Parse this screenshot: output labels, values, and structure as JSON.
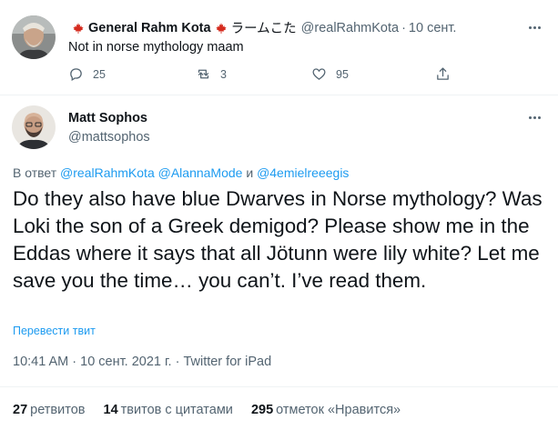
{
  "reply_tweet": {
    "display_name": "General Rahm Kota",
    "display_name_suffix": "ラームこた",
    "handle": "@realRahmKota",
    "separator": "·",
    "time": "10 сент.",
    "text": "Not in norse mythology maam",
    "flag_icon": "maple-leaf-icon",
    "flag_color": "#d52b1e",
    "actions": {
      "reply_count": "25",
      "retweet_count": "3",
      "like_count": "95"
    }
  },
  "main_tweet": {
    "display_name": "Matt Sophos",
    "handle": "@mattsophos",
    "replying_prefix": "В ответ",
    "mentions": [
      "@realRahmKota",
      "@AlannaMode",
      "@4emielreeegis"
    ],
    "mention_conjunction": "и",
    "text": "Do they also have blue Dwarves in Norse mythology? Was Loki the son of a Greek demigod? Please show me in the Eddas where it says that all Jötunn were lily white? Let me save you the time… you can’t. I’ve read them.",
    "translate_label": "Перевести твит",
    "timestamp": "10:41 AM · 10 сент. 2021 г. · Twitter for iPad",
    "stats": {
      "retweets_count": "27",
      "retweets_label": "ретвитов",
      "quotes_count": "14",
      "quotes_label": "твитов с цитатами",
      "likes_count": "295",
      "likes_label": "отметок «Нравится»"
    }
  },
  "colors": {
    "link": "#1d9bf0",
    "secondary_text": "#536471",
    "primary_text": "#0f1419",
    "divider": "#eff3f4"
  }
}
